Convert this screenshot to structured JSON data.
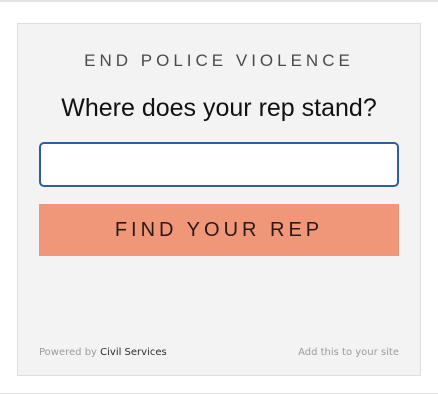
{
  "widget": {
    "campaign_heading": "END POLICE VIOLENCE",
    "question": "Where does your rep stand?",
    "address_input": {
      "value": "",
      "placeholder": ""
    },
    "button_label": "FIND YOUR REP",
    "footer": {
      "powered_by_prefix": "Powered by ",
      "powered_by_brand": "Civil Services",
      "add_to_site": "Add this to your site"
    }
  },
  "colors": {
    "button_background": "#f0977a",
    "input_focus_border": "#2a5ea7",
    "card_background": "#f3f3f3"
  }
}
